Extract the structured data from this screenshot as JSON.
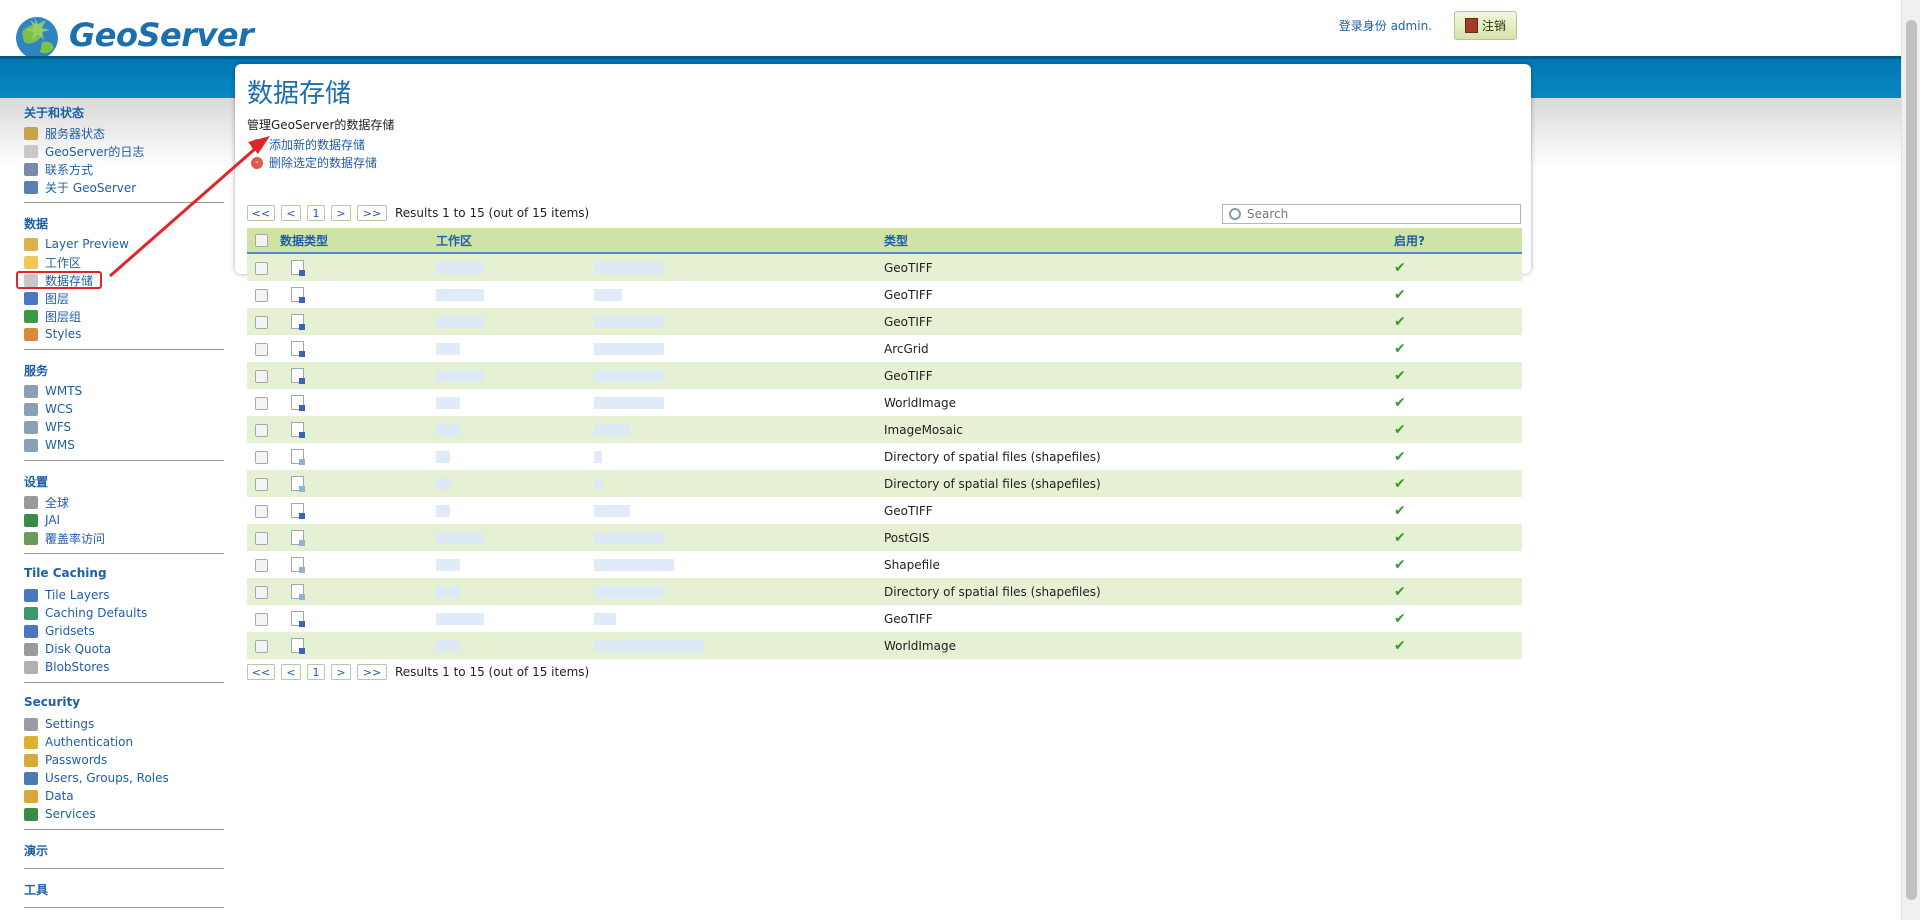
{
  "header": {
    "logo_text": "GeoServer",
    "login_text": "登录身份 admin.",
    "logout_label": "注销"
  },
  "sidebar": {
    "sections": [
      {
        "title": "关于和状态",
        "items": [
          {
            "label": "服务器状态",
            "icon": "server-status-icon",
            "color": "#c9a34a"
          },
          {
            "label": "GeoServer的日志",
            "icon": "log-icon",
            "color": "#c9c9c9"
          },
          {
            "label": "联系方式",
            "icon": "contact-icon",
            "color": "#7a8aa8"
          },
          {
            "label": "关于 GeoServer",
            "icon": "about-icon",
            "color": "#5a7fb0"
          }
        ]
      },
      {
        "title": "数据",
        "items": [
          {
            "label": "Layer Preview",
            "icon": "layer-preview-icon",
            "color": "#d9b24a"
          },
          {
            "label": "工作区",
            "icon": "folder-icon",
            "color": "#f0c858"
          },
          {
            "label": "数据存储",
            "icon": "datastore-icon",
            "color": "#c8c8c8"
          },
          {
            "label": "图层",
            "icon": "layer-icon",
            "color": "#4a78c0"
          },
          {
            "label": "图层组",
            "icon": "layer-group-icon",
            "color": "#3a9a4a"
          },
          {
            "label": "Styles",
            "icon": "styles-icon",
            "color": "#d88a3a"
          }
        ]
      },
      {
        "title": "服务",
        "items": [
          {
            "label": "WMTS",
            "icon": "wmts-icon",
            "color": "#8aa0b8"
          },
          {
            "label": "WCS",
            "icon": "wcs-icon",
            "color": "#8aa0b8"
          },
          {
            "label": "WFS",
            "icon": "wfs-icon",
            "color": "#8aa0b8"
          },
          {
            "label": "WMS",
            "icon": "wms-icon",
            "color": "#8aa0b8"
          }
        ]
      },
      {
        "title": "设置",
        "items": [
          {
            "label": "全球",
            "icon": "global-icon",
            "color": "#9a9a9a"
          },
          {
            "label": "JAI",
            "icon": "jai-icon",
            "color": "#3a8a4a"
          },
          {
            "label": "覆盖率访问",
            "icon": "coverage-access-icon",
            "color": "#6a9a5a"
          }
        ]
      },
      {
        "title": "Tile Caching",
        "items": [
          {
            "label": "Tile Layers",
            "icon": "tile-layers-icon",
            "color": "#4a78c0"
          },
          {
            "label": "Caching Defaults",
            "icon": "caching-defaults-icon",
            "color": "#3a9a6a"
          },
          {
            "label": "Gridsets",
            "icon": "gridsets-icon",
            "color": "#4a78c0"
          },
          {
            "label": "Disk Quota",
            "icon": "disk-quota-icon",
            "color": "#9a9a9a"
          },
          {
            "label": "BlobStores",
            "icon": "blobstores-icon",
            "color": "#b0b0b0"
          }
        ]
      },
      {
        "title": "Security",
        "items": [
          {
            "label": "Settings",
            "icon": "settings-icon",
            "color": "#9a9aa8"
          },
          {
            "label": "Authentication",
            "icon": "authentication-icon",
            "color": "#e0b030"
          },
          {
            "label": "Passwords",
            "icon": "passwords-icon",
            "color": "#d8a83a"
          },
          {
            "label": "Users, Groups, Roles",
            "icon": "users-icon",
            "color": "#4a7ab0"
          },
          {
            "label": "Data",
            "icon": "data-security-icon",
            "color": "#d8a83a"
          },
          {
            "label": "Services",
            "icon": "services-security-icon",
            "color": "#3a8a4a"
          }
        ]
      },
      {
        "title": "演示",
        "items": []
      },
      {
        "title": "工具",
        "items": []
      }
    ],
    "active_item": "数据存储"
  },
  "main": {
    "title": "数据存储",
    "description": "管理GeoServer的数据存储",
    "add_label": "添加新的数据存储",
    "remove_label": "删除选定的数据存储",
    "search_placeholder": "Search",
    "pager": {
      "first": "<<",
      "prev": "<",
      "page": "1",
      "next": ">",
      "last": ">>",
      "results": "Results 1 to 15 (out of 15 items)"
    },
    "columns": [
      "数据类型",
      "工作区",
      "",
      "类型",
      "启用?"
    ],
    "rows": [
      {
        "type": "GeoTIFF",
        "icon": "raster"
      },
      {
        "type": "GeoTIFF",
        "icon": "raster"
      },
      {
        "type": "GeoTIFF",
        "icon": "raster"
      },
      {
        "type": "ArcGrid",
        "icon": "raster"
      },
      {
        "type": "GeoTIFF",
        "icon": "raster"
      },
      {
        "type": "WorldImage",
        "icon": "raster"
      },
      {
        "type": "ImageMosaic",
        "icon": "raster"
      },
      {
        "type": "Directory of spatial files (shapefiles)",
        "icon": "vector"
      },
      {
        "type": "Directory of spatial files (shapefiles)",
        "icon": "vector"
      },
      {
        "type": "GeoTIFF",
        "icon": "raster"
      },
      {
        "type": "PostGIS",
        "icon": "vector"
      },
      {
        "type": "Shapefile",
        "icon": "vector"
      },
      {
        "type": "Directory of spatial files (shapefiles)",
        "icon": "vector"
      },
      {
        "type": "GeoTIFF",
        "icon": "raster"
      },
      {
        "type": "WorldImage",
        "icon": "raster"
      }
    ]
  },
  "colors": {
    "accent": "#1b6fae",
    "banner": "#0a89c4",
    "row_alt": "#e6f0d3",
    "annotation": "#e0262a"
  }
}
